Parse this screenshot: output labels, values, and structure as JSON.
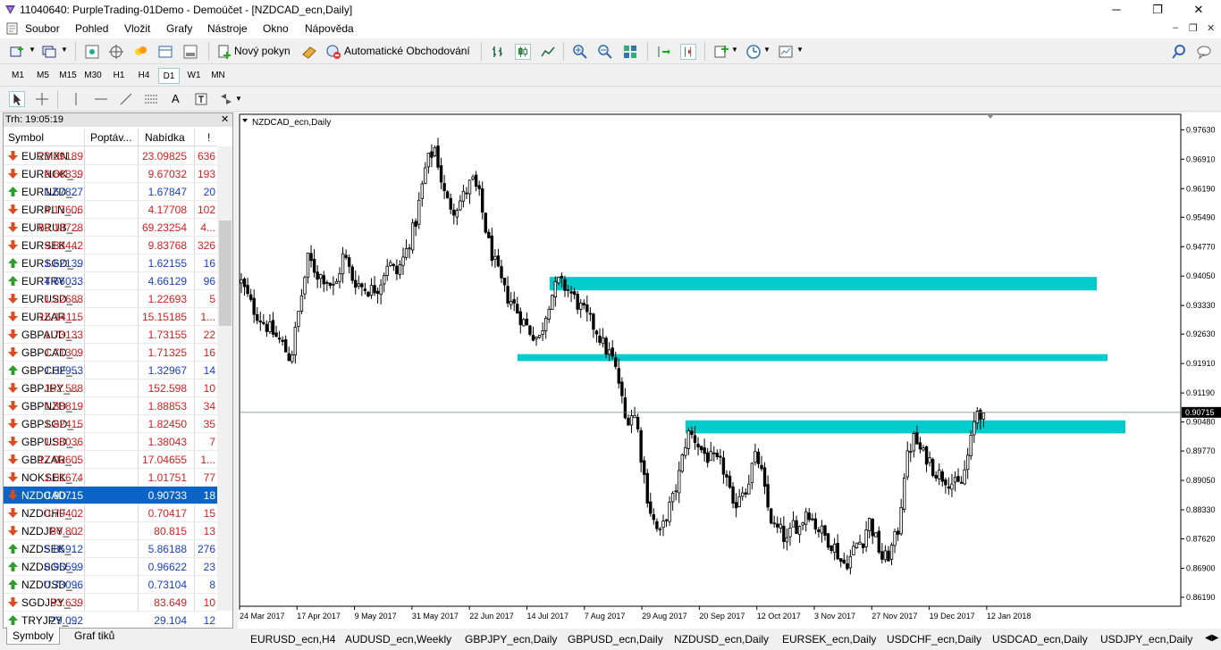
{
  "window": {
    "title": "11040640: PurpleTrading-01Demo - Demoúčet - [NZDCAD_ecn,Daily]",
    "minimize": "─",
    "restore": "❐",
    "close": "✕"
  },
  "menu": {
    "items": [
      "Soubor",
      "Pohled",
      "Vložit",
      "Grafy",
      "Nástroje",
      "Okno",
      "Nápověda"
    ],
    "mdi": {
      "minimize": "–",
      "restore": "❐",
      "close": "✕"
    }
  },
  "toolbar": {
    "new_order": "Nový pokyn",
    "auto_trading": "Automatické Obchodování"
  },
  "timeframes": [
    "M1",
    "M5",
    "M15",
    "M30",
    "H1",
    "H4",
    "D1",
    "W1",
    "MN"
  ],
  "active_timeframe": "D1",
  "drawing_tools": {
    "text_tool": "A"
  },
  "market_watch": {
    "time_label": "Trh: 19:05:19",
    "columns": [
      "Symbol",
      "Poptáv...",
      "Nabídka",
      "!"
    ],
    "rows": [
      {
        "symbol": "EURMXN...",
        "bid": "23.09189",
        "ask": "23.09825",
        "spread": "636",
        "dir": "down"
      },
      {
        "symbol": "EURNOK_...",
        "bid": "9.66839",
        "ask": "9.67032",
        "spread": "193",
        "dir": "down"
      },
      {
        "symbol": "EURNZD_...",
        "bid": "1.67827",
        "ask": "1.67847",
        "spread": "20",
        "dir": "up"
      },
      {
        "symbol": "EURPLN_...",
        "bid": "4.17606",
        "ask": "4.17708",
        "spread": "102",
        "dir": "down"
      },
      {
        "symbol": "EURRUB_...",
        "bid": "69.18728",
        "ask": "69.23254",
        "spread": "4...",
        "dir": "down"
      },
      {
        "symbol": "EURSEK_...",
        "bid": "9.83442",
        "ask": "9.83768",
        "spread": "326",
        "dir": "down"
      },
      {
        "symbol": "EURSGD_...",
        "bid": "1.62139",
        "ask": "1.62155",
        "spread": "16",
        "dir": "up"
      },
      {
        "symbol": "EURTRY_...",
        "bid": "4.66033",
        "ask": "4.66129",
        "spread": "96",
        "dir": "up"
      },
      {
        "symbol": "EURUSD_...",
        "bid": "1.22688",
        "ask": "1.22693",
        "spread": "5",
        "dir": "down"
      },
      {
        "symbol": "EURZAR_...",
        "bid": "15.14115",
        "ask": "15.15185",
        "spread": "1...",
        "dir": "down"
      },
      {
        "symbol": "GBPAUD_...",
        "bid": "1.73133",
        "ask": "1.73155",
        "spread": "22",
        "dir": "down"
      },
      {
        "symbol": "GBPCAD_...",
        "bid": "1.71309",
        "ask": "1.71325",
        "spread": "16",
        "dir": "down"
      },
      {
        "symbol": "GBPCHF_...",
        "bid": "1.32953",
        "ask": "1.32967",
        "spread": "14",
        "dir": "up"
      },
      {
        "symbol": "GBPJPY_...",
        "bid": "152.588",
        "ask": "152.598",
        "spread": "10",
        "dir": "down"
      },
      {
        "symbol": "GBPNZD_...",
        "bid": "1.88819",
        "ask": "1.88853",
        "spread": "34",
        "dir": "down"
      },
      {
        "symbol": "GBPSGD_...",
        "bid": "1.82415",
        "ask": "1.82450",
        "spread": "35",
        "dir": "down"
      },
      {
        "symbol": "GBPUSD_...",
        "bid": "1.38036",
        "ask": "1.38043",
        "spread": "7",
        "dir": "down"
      },
      {
        "symbol": "GBPZAR_...",
        "bid": "17.03605",
        "ask": "17.04655",
        "spread": "1...",
        "dir": "down"
      },
      {
        "symbol": "NOKSEK_...",
        "bid": "1.01674",
        "ask": "1.01751",
        "spread": "77",
        "dir": "down"
      },
      {
        "symbol": "NZDCAD...",
        "bid": "0.90715",
        "ask": "0.90733",
        "spread": "18",
        "dir": "down",
        "selected": true
      },
      {
        "symbol": "NZDCHF_...",
        "bid": "0.70402",
        "ask": "0.70417",
        "spread": "15",
        "dir": "down"
      },
      {
        "symbol": "NZDJPY_...",
        "bid": "80.802",
        "ask": "80.815",
        "spread": "13",
        "dir": "down"
      },
      {
        "symbol": "NZDSEK_...",
        "bid": "5.85912",
        "ask": "5.86188",
        "spread": "276",
        "dir": "up"
      },
      {
        "symbol": "NZDSGD_...",
        "bid": "0.96599",
        "ask": "0.96622",
        "spread": "23",
        "dir": "up"
      },
      {
        "symbol": "NZDUSD_...",
        "bid": "0.73096",
        "ask": "0.73104",
        "spread": "8",
        "dir": "up"
      },
      {
        "symbol": "SGDJPY_...",
        "bid": "83.639",
        "ask": "83.649",
        "spread": "10",
        "dir": "down"
      },
      {
        "symbol": "TRYJPY_...",
        "bid": "29.092",
        "ask": "29.104",
        "spread": "12",
        "dir": "up"
      }
    ],
    "tabs": [
      "Symboly",
      "Graf tiků"
    ]
  },
  "chart_tabs": [
    "EURUSD_ecn,H4",
    "AUDUSD_ecn,Weekly",
    "GBPJPY_ecn,Daily",
    "GBPUSD_ecn,Daily",
    "NZDUSD_ecn,Daily",
    "EURSEK_ecn,Daily",
    "USDCHF_ecn,Daily",
    "USDCAD_ecn,Daily",
    "USDJPY_ecn,Daily"
  ],
  "colors": {
    "zone": "#00cccc",
    "bull": "#000000",
    "bear": "#000000",
    "price_label_bg": "#000000",
    "up_arrow": "#2aa02a",
    "down_arrow": "#e04a1a",
    "selected_row": "#0a64c8"
  },
  "chart_data": {
    "type": "candlestick",
    "title": "NZDCAD_ecn,Daily",
    "current_price": 0.90715,
    "ylim": [
      0.8597,
      0.9801
    ],
    "y_ticks": [
      0.9763,
      0.9691,
      0.9619,
      0.9549,
      0.9477,
      0.9405,
      0.9333,
      0.9263,
      0.9191,
      0.9119,
      0.9048,
      0.8977,
      0.8905,
      0.8833,
      0.8762,
      0.869,
      0.8619
    ],
    "y_tick_labels": [
      "0.97630",
      "0.96910",
      "0.96190",
      "0.95490",
      "0.94770",
      "0.94050",
      "0.93330",
      "0.92630",
      "0.91910",
      "0.91190",
      "0.90480",
      "0.89770",
      "0.89050",
      "0.88330",
      "0.87620",
      "0.86900",
      "0.86190"
    ],
    "x_labels": [
      "24 Mar 2017",
      "17 Apr 2017",
      "9 May 2017",
      "31 May 2017",
      "22 Jun 2017",
      "14 Jul 2017",
      "7 Aug 2017",
      "29 Aug 2017",
      "20 Sep 2017",
      "12 Oct 2017",
      "3 Nov 2017",
      "27 Nov 2017",
      "19 Dec 2017",
      "12 Jan 2018"
    ],
    "zones": [
      {
        "from": "14 Jul 2017",
        "to": "12 Jan 2018",
        "low": 0.937,
        "high": 0.9403
      },
      {
        "from": "14 Jul 2017",
        "to": "12 Jan 2018",
        "low": 0.9197,
        "high": 0.9214
      },
      {
        "from": "29 Aug 2017",
        "to": "12 Jan 2018",
        "low": 0.902,
        "high": 0.9052
      }
    ],
    "close_path": [
      [
        0,
        0.939
      ],
      [
        12,
        0.933
      ],
      [
        22,
        0.93
      ],
      [
        34,
        0.927
      ],
      [
        46,
        0.924
      ],
      [
        56,
        0.92
      ],
      [
        66,
        0.933
      ],
      [
        76,
        0.945
      ],
      [
        86,
        0.941
      ],
      [
        96,
        0.94
      ],
      [
        106,
        0.937
      ],
      [
        116,
        0.946
      ],
      [
        126,
        0.94
      ],
      [
        136,
        0.938
      ],
      [
        146,
        0.937
      ],
      [
        156,
        0.938
      ],
      [
        166,
        0.944
      ],
      [
        176,
        0.941
      ],
      [
        186,
        0.946
      ],
      [
        198,
        0.954
      ],
      [
        210,
        0.968
      ],
      [
        220,
        0.972
      ],
      [
        226,
        0.965
      ],
      [
        232,
        0.959
      ],
      [
        242,
        0.957
      ],
      [
        252,
        0.96
      ],
      [
        262,
        0.964
      ],
      [
        270,
        0.96
      ],
      [
        280,
        0.949
      ],
      [
        290,
        0.942
      ],
      [
        300,
        0.936
      ],
      [
        308,
        0.934
      ],
      [
        318,
        0.93
      ],
      [
        328,
        0.927
      ],
      [
        338,
        0.925
      ],
      [
        350,
        0.935
      ],
      [
        360,
        0.939
      ],
      [
        372,
        0.937
      ],
      [
        384,
        0.933
      ],
      [
        394,
        0.93
      ],
      [
        404,
        0.927
      ],
      [
        412,
        0.923
      ],
      [
        420,
        0.921
      ],
      [
        428,
        0.915
      ],
      [
        436,
        0.905
      ],
      [
        442,
        0.907
      ],
      [
        448,
        0.906
      ],
      [
        454,
        0.896
      ],
      [
        462,
        0.885
      ],
      [
        470,
        0.879
      ],
      [
        476,
        0.877
      ],
      [
        482,
        0.882
      ],
      [
        490,
        0.886
      ],
      [
        498,
        0.893
      ],
      [
        506,
        0.902
      ],
      [
        514,
        0.901
      ],
      [
        522,
        0.898
      ],
      [
        530,
        0.896
      ],
      [
        538,
        0.895
      ],
      [
        546,
        0.894
      ],
      [
        552,
        0.89
      ],
      [
        558,
        0.883
      ],
      [
        566,
        0.888
      ],
      [
        574,
        0.889
      ],
      [
        582,
        0.896
      ],
      [
        588,
        0.895
      ],
      [
        596,
        0.885
      ],
      [
        604,
        0.879
      ],
      [
        612,
        0.878
      ],
      [
        620,
        0.875
      ],
      [
        626,
        0.88
      ],
      [
        634,
        0.879
      ],
      [
        642,
        0.884
      ],
      [
        650,
        0.88
      ],
      [
        658,
        0.878
      ],
      [
        666,
        0.876
      ],
      [
        674,
        0.874
      ],
      [
        682,
        0.87
      ],
      [
        690,
        0.871
      ],
      [
        698,
        0.875
      ],
      [
        706,
        0.876
      ],
      [
        712,
        0.881
      ],
      [
        720,
        0.876
      ],
      [
        728,
        0.871
      ],
      [
        734,
        0.872
      ],
      [
        740,
        0.875
      ],
      [
        746,
        0.879
      ],
      [
        752,
        0.892
      ],
      [
        758,
        0.898
      ],
      [
        764,
        0.901
      ],
      [
        772,
        0.897
      ],
      [
        780,
        0.896
      ],
      [
        786,
        0.893
      ],
      [
        792,
        0.892
      ],
      [
        800,
        0.891
      ],
      [
        806,
        0.89
      ],
      [
        812,
        0.889
      ],
      [
        818,
        0.89
      ],
      [
        824,
        0.896
      ],
      [
        830,
        0.902
      ],
      [
        834,
        0.908
      ],
      [
        840,
        0.907
      ],
      [
        844,
        0.904
      ]
    ]
  }
}
